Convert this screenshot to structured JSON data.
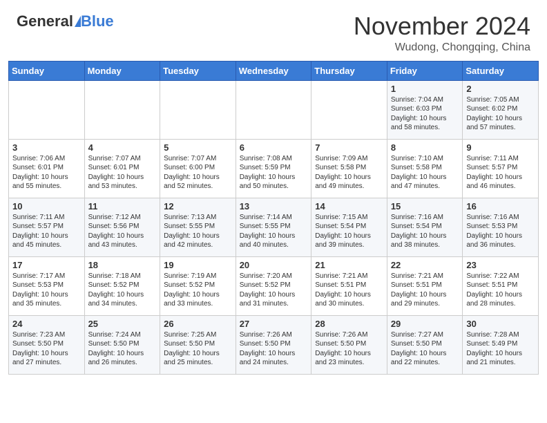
{
  "header": {
    "logo_general": "General",
    "logo_blue": "Blue",
    "month_title": "November 2024",
    "location": "Wudong, Chongqing, China"
  },
  "days_of_week": [
    "Sunday",
    "Monday",
    "Tuesday",
    "Wednesday",
    "Thursday",
    "Friday",
    "Saturday"
  ],
  "weeks": [
    [
      {
        "day": "",
        "info": ""
      },
      {
        "day": "",
        "info": ""
      },
      {
        "day": "",
        "info": ""
      },
      {
        "day": "",
        "info": ""
      },
      {
        "day": "",
        "info": ""
      },
      {
        "day": "1",
        "info": "Sunrise: 7:04 AM\nSunset: 6:03 PM\nDaylight: 10 hours\nand 58 minutes."
      },
      {
        "day": "2",
        "info": "Sunrise: 7:05 AM\nSunset: 6:02 PM\nDaylight: 10 hours\nand 57 minutes."
      }
    ],
    [
      {
        "day": "3",
        "info": "Sunrise: 7:06 AM\nSunset: 6:01 PM\nDaylight: 10 hours\nand 55 minutes."
      },
      {
        "day": "4",
        "info": "Sunrise: 7:07 AM\nSunset: 6:01 PM\nDaylight: 10 hours\nand 53 minutes."
      },
      {
        "day": "5",
        "info": "Sunrise: 7:07 AM\nSunset: 6:00 PM\nDaylight: 10 hours\nand 52 minutes."
      },
      {
        "day": "6",
        "info": "Sunrise: 7:08 AM\nSunset: 5:59 PM\nDaylight: 10 hours\nand 50 minutes."
      },
      {
        "day": "7",
        "info": "Sunrise: 7:09 AM\nSunset: 5:58 PM\nDaylight: 10 hours\nand 49 minutes."
      },
      {
        "day": "8",
        "info": "Sunrise: 7:10 AM\nSunset: 5:58 PM\nDaylight: 10 hours\nand 47 minutes."
      },
      {
        "day": "9",
        "info": "Sunrise: 7:11 AM\nSunset: 5:57 PM\nDaylight: 10 hours\nand 46 minutes."
      }
    ],
    [
      {
        "day": "10",
        "info": "Sunrise: 7:11 AM\nSunset: 5:57 PM\nDaylight: 10 hours\nand 45 minutes."
      },
      {
        "day": "11",
        "info": "Sunrise: 7:12 AM\nSunset: 5:56 PM\nDaylight: 10 hours\nand 43 minutes."
      },
      {
        "day": "12",
        "info": "Sunrise: 7:13 AM\nSunset: 5:55 PM\nDaylight: 10 hours\nand 42 minutes."
      },
      {
        "day": "13",
        "info": "Sunrise: 7:14 AM\nSunset: 5:55 PM\nDaylight: 10 hours\nand 40 minutes."
      },
      {
        "day": "14",
        "info": "Sunrise: 7:15 AM\nSunset: 5:54 PM\nDaylight: 10 hours\nand 39 minutes."
      },
      {
        "day": "15",
        "info": "Sunrise: 7:16 AM\nSunset: 5:54 PM\nDaylight: 10 hours\nand 38 minutes."
      },
      {
        "day": "16",
        "info": "Sunrise: 7:16 AM\nSunset: 5:53 PM\nDaylight: 10 hours\nand 36 minutes."
      }
    ],
    [
      {
        "day": "17",
        "info": "Sunrise: 7:17 AM\nSunset: 5:53 PM\nDaylight: 10 hours\nand 35 minutes."
      },
      {
        "day": "18",
        "info": "Sunrise: 7:18 AM\nSunset: 5:52 PM\nDaylight: 10 hours\nand 34 minutes."
      },
      {
        "day": "19",
        "info": "Sunrise: 7:19 AM\nSunset: 5:52 PM\nDaylight: 10 hours\nand 33 minutes."
      },
      {
        "day": "20",
        "info": "Sunrise: 7:20 AM\nSunset: 5:52 PM\nDaylight: 10 hours\nand 31 minutes."
      },
      {
        "day": "21",
        "info": "Sunrise: 7:21 AM\nSunset: 5:51 PM\nDaylight: 10 hours\nand 30 minutes."
      },
      {
        "day": "22",
        "info": "Sunrise: 7:21 AM\nSunset: 5:51 PM\nDaylight: 10 hours\nand 29 minutes."
      },
      {
        "day": "23",
        "info": "Sunrise: 7:22 AM\nSunset: 5:51 PM\nDaylight: 10 hours\nand 28 minutes."
      }
    ],
    [
      {
        "day": "24",
        "info": "Sunrise: 7:23 AM\nSunset: 5:50 PM\nDaylight: 10 hours\nand 27 minutes."
      },
      {
        "day": "25",
        "info": "Sunrise: 7:24 AM\nSunset: 5:50 PM\nDaylight: 10 hours\nand 26 minutes."
      },
      {
        "day": "26",
        "info": "Sunrise: 7:25 AM\nSunset: 5:50 PM\nDaylight: 10 hours\nand 25 minutes."
      },
      {
        "day": "27",
        "info": "Sunrise: 7:26 AM\nSunset: 5:50 PM\nDaylight: 10 hours\nand 24 minutes."
      },
      {
        "day": "28",
        "info": "Sunrise: 7:26 AM\nSunset: 5:50 PM\nDaylight: 10 hours\nand 23 minutes."
      },
      {
        "day": "29",
        "info": "Sunrise: 7:27 AM\nSunset: 5:50 PM\nDaylight: 10 hours\nand 22 minutes."
      },
      {
        "day": "30",
        "info": "Sunrise: 7:28 AM\nSunset: 5:49 PM\nDaylight: 10 hours\nand 21 minutes."
      }
    ]
  ]
}
